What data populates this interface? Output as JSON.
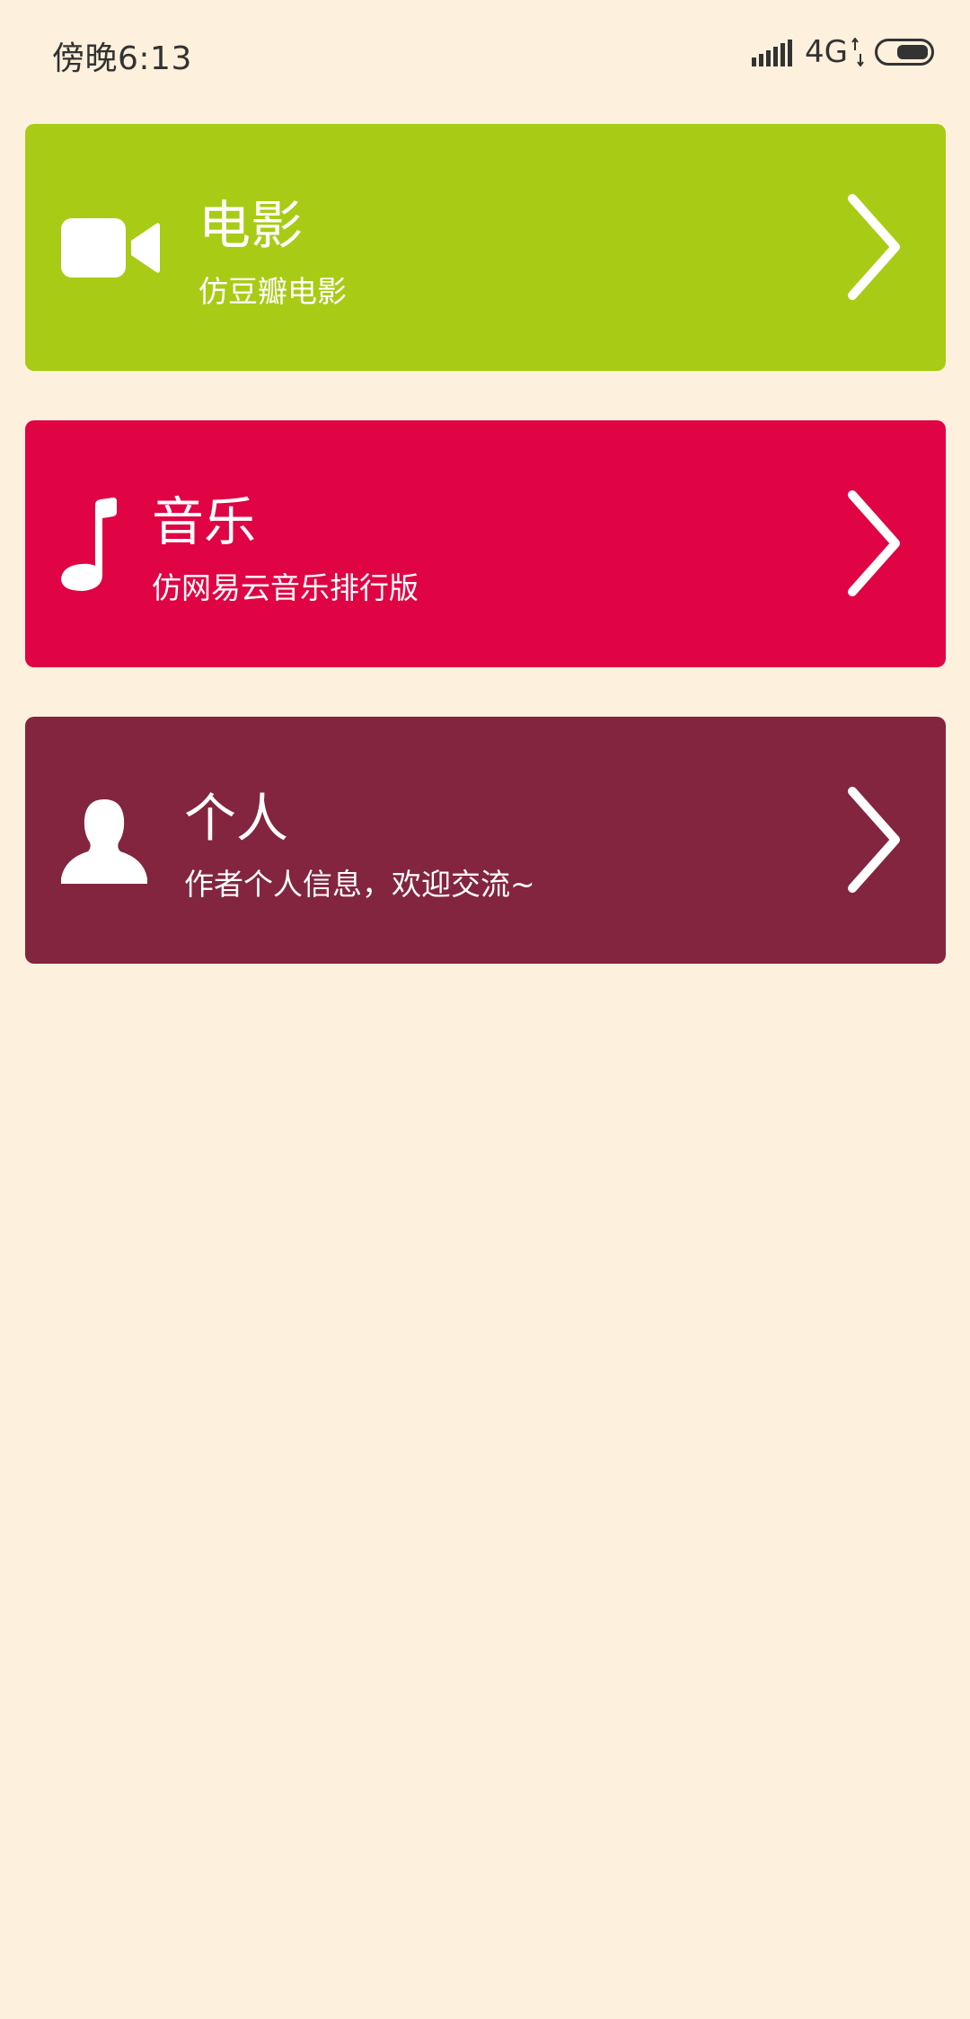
{
  "status_bar": {
    "time": "傍晚6:13",
    "network": "4G",
    "signal_icon": "signal-bars-icon",
    "data_arrows_icon": "data-activity-icon",
    "battery_icon": "battery-icon"
  },
  "cards": [
    {
      "title": "电影",
      "subtitle": "仿豆瓣电影",
      "icon": "video-camera-icon",
      "color": "#a8cb16"
    },
    {
      "title": "音乐",
      "subtitle": "仿网易云音乐排行版",
      "icon": "music-note-icon",
      "color": "#e00444"
    },
    {
      "title": "个人",
      "subtitle": "作者个人信息，欢迎交流~",
      "icon": "person-icon",
      "color": "#83253e"
    }
  ],
  "chevron_icon": "chevron-right-icon",
  "colors": {
    "background": "#fdf0dc",
    "status_text": "#333333",
    "card_text": "#ffffff"
  }
}
